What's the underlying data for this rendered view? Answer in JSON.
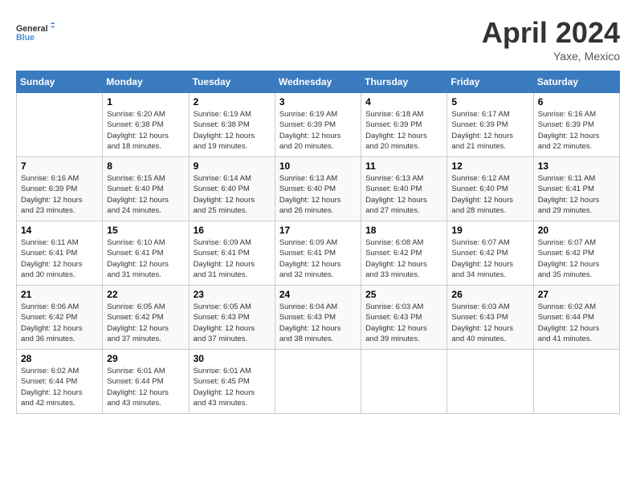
{
  "logo": {
    "line1": "General",
    "line2": "Blue"
  },
  "title": "April 2024",
  "location": "Yaxe, Mexico",
  "days_of_week": [
    "Sunday",
    "Monday",
    "Tuesday",
    "Wednesday",
    "Thursday",
    "Friday",
    "Saturday"
  ],
  "weeks": [
    [
      {
        "day": "",
        "info": ""
      },
      {
        "day": "1",
        "info": "Sunrise: 6:20 AM\nSunset: 6:38 PM\nDaylight: 12 hours\nand 18 minutes."
      },
      {
        "day": "2",
        "info": "Sunrise: 6:19 AM\nSunset: 6:38 PM\nDaylight: 12 hours\nand 19 minutes."
      },
      {
        "day": "3",
        "info": "Sunrise: 6:19 AM\nSunset: 6:39 PM\nDaylight: 12 hours\nand 20 minutes."
      },
      {
        "day": "4",
        "info": "Sunrise: 6:18 AM\nSunset: 6:39 PM\nDaylight: 12 hours\nand 20 minutes."
      },
      {
        "day": "5",
        "info": "Sunrise: 6:17 AM\nSunset: 6:39 PM\nDaylight: 12 hours\nand 21 minutes."
      },
      {
        "day": "6",
        "info": "Sunrise: 6:16 AM\nSunset: 6:39 PM\nDaylight: 12 hours\nand 22 minutes."
      }
    ],
    [
      {
        "day": "7",
        "info": "Sunrise: 6:16 AM\nSunset: 6:39 PM\nDaylight: 12 hours\nand 23 minutes."
      },
      {
        "day": "8",
        "info": "Sunrise: 6:15 AM\nSunset: 6:40 PM\nDaylight: 12 hours\nand 24 minutes."
      },
      {
        "day": "9",
        "info": "Sunrise: 6:14 AM\nSunset: 6:40 PM\nDaylight: 12 hours\nand 25 minutes."
      },
      {
        "day": "10",
        "info": "Sunrise: 6:13 AM\nSunset: 6:40 PM\nDaylight: 12 hours\nand 26 minutes."
      },
      {
        "day": "11",
        "info": "Sunrise: 6:13 AM\nSunset: 6:40 PM\nDaylight: 12 hours\nand 27 minutes."
      },
      {
        "day": "12",
        "info": "Sunrise: 6:12 AM\nSunset: 6:40 PM\nDaylight: 12 hours\nand 28 minutes."
      },
      {
        "day": "13",
        "info": "Sunrise: 6:11 AM\nSunset: 6:41 PM\nDaylight: 12 hours\nand 29 minutes."
      }
    ],
    [
      {
        "day": "14",
        "info": "Sunrise: 6:11 AM\nSunset: 6:41 PM\nDaylight: 12 hours\nand 30 minutes."
      },
      {
        "day": "15",
        "info": "Sunrise: 6:10 AM\nSunset: 6:41 PM\nDaylight: 12 hours\nand 31 minutes."
      },
      {
        "day": "16",
        "info": "Sunrise: 6:09 AM\nSunset: 6:41 PM\nDaylight: 12 hours\nand 31 minutes."
      },
      {
        "day": "17",
        "info": "Sunrise: 6:09 AM\nSunset: 6:41 PM\nDaylight: 12 hours\nand 32 minutes."
      },
      {
        "day": "18",
        "info": "Sunrise: 6:08 AM\nSunset: 6:42 PM\nDaylight: 12 hours\nand 33 minutes."
      },
      {
        "day": "19",
        "info": "Sunrise: 6:07 AM\nSunset: 6:42 PM\nDaylight: 12 hours\nand 34 minutes."
      },
      {
        "day": "20",
        "info": "Sunrise: 6:07 AM\nSunset: 6:42 PM\nDaylight: 12 hours\nand 35 minutes."
      }
    ],
    [
      {
        "day": "21",
        "info": "Sunrise: 6:06 AM\nSunset: 6:42 PM\nDaylight: 12 hours\nand 36 minutes."
      },
      {
        "day": "22",
        "info": "Sunrise: 6:05 AM\nSunset: 6:42 PM\nDaylight: 12 hours\nand 37 minutes."
      },
      {
        "day": "23",
        "info": "Sunrise: 6:05 AM\nSunset: 6:43 PM\nDaylight: 12 hours\nand 37 minutes."
      },
      {
        "day": "24",
        "info": "Sunrise: 6:04 AM\nSunset: 6:43 PM\nDaylight: 12 hours\nand 38 minutes."
      },
      {
        "day": "25",
        "info": "Sunrise: 6:03 AM\nSunset: 6:43 PM\nDaylight: 12 hours\nand 39 minutes."
      },
      {
        "day": "26",
        "info": "Sunrise: 6:03 AM\nSunset: 6:43 PM\nDaylight: 12 hours\nand 40 minutes."
      },
      {
        "day": "27",
        "info": "Sunrise: 6:02 AM\nSunset: 6:44 PM\nDaylight: 12 hours\nand 41 minutes."
      }
    ],
    [
      {
        "day": "28",
        "info": "Sunrise: 6:02 AM\nSunset: 6:44 PM\nDaylight: 12 hours\nand 42 minutes."
      },
      {
        "day": "29",
        "info": "Sunrise: 6:01 AM\nSunset: 6:44 PM\nDaylight: 12 hours\nand 43 minutes."
      },
      {
        "day": "30",
        "info": "Sunrise: 6:01 AM\nSunset: 6:45 PM\nDaylight: 12 hours\nand 43 minutes."
      },
      {
        "day": "",
        "info": ""
      },
      {
        "day": "",
        "info": ""
      },
      {
        "day": "",
        "info": ""
      },
      {
        "day": "",
        "info": ""
      }
    ]
  ]
}
